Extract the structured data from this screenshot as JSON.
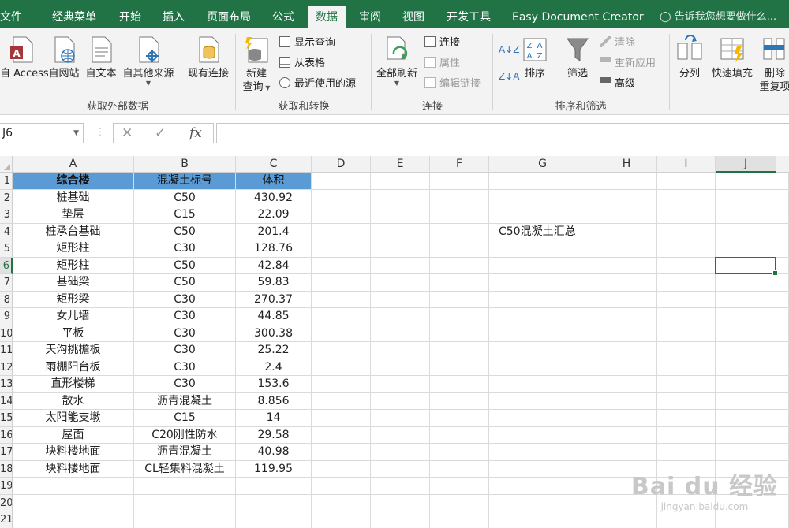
{
  "tabs": [
    {
      "label": "文件",
      "active": false
    },
    {
      "label": "经典菜单",
      "active": false
    },
    {
      "label": "开始",
      "active": false
    },
    {
      "label": "插入",
      "active": false
    },
    {
      "label": "页面布局",
      "active": false
    },
    {
      "label": "公式",
      "active": false
    },
    {
      "label": "数据",
      "active": true
    },
    {
      "label": "审阅",
      "active": false
    },
    {
      "label": "视图",
      "active": false
    },
    {
      "label": "开发工具",
      "active": false
    },
    {
      "label": "Easy Document Creator",
      "active": false
    }
  ],
  "tell_me": "告诉我您想要做什么...",
  "ribbon": {
    "external": {
      "access": "自 Access",
      "web": "自网站",
      "text": "自文本",
      "other": "自其他来源",
      "existing": "现有连接",
      "group": "获取外部数据"
    },
    "transform": {
      "new_query_1": "新建",
      "new_query_2": "查询",
      "show_queries": "显示查询",
      "from_table": "从表格",
      "recent_sources": "最近使用的源",
      "group": "获取和转换"
    },
    "connections": {
      "refresh_all": "全部刷新",
      "connections": "连接",
      "properties": "属性",
      "edit_links": "编辑链接",
      "group": "连接"
    },
    "sort_filter": {
      "sort": "排序",
      "filter": "筛选",
      "clear": "清除",
      "reapply": "重新应用",
      "advanced": "高级",
      "group": "排序和筛选"
    },
    "tools": {
      "split": "分列",
      "flash_fill": "快速填充",
      "remove_dup_1": "删除",
      "remove_dup_2": "重复项"
    }
  },
  "formula_bar": {
    "name_box": "J6",
    "formula": ""
  },
  "columns": [
    "A",
    "B",
    "C",
    "D",
    "E",
    "F",
    "G",
    "H",
    "I",
    "J"
  ],
  "rows": [
    "1",
    "2",
    "3",
    "4",
    "5",
    "6",
    "7",
    "8",
    "9",
    "10",
    "11",
    "12",
    "13",
    "14",
    "15",
    "16",
    "17",
    "18",
    "19",
    "20",
    "21"
  ],
  "selected_cell": "J6",
  "table": {
    "headers": [
      "综合楼",
      "混凝土标号",
      "体积"
    ],
    "rows": [
      [
        "桩基础",
        "C50",
        "430.92"
      ],
      [
        "垫层",
        "C15",
        "22.09"
      ],
      [
        "桩承台基础",
        "C50",
        "201.4"
      ],
      [
        "矩形柱",
        "C30",
        "128.76"
      ],
      [
        "矩形柱",
        "C50",
        "42.84"
      ],
      [
        "基础梁",
        "C50",
        "59.83"
      ],
      [
        "矩形梁",
        "C30",
        "270.37"
      ],
      [
        "女儿墙",
        "C30",
        "44.85"
      ],
      [
        "平板",
        "C30",
        "300.38"
      ],
      [
        "天沟挑檐板",
        "C30",
        "25.22"
      ],
      [
        "雨棚阳台板",
        "C30",
        "2.4"
      ],
      [
        "直形楼梯",
        "C30",
        "153.6"
      ],
      [
        "散水",
        "沥青混凝土",
        "8.856"
      ],
      [
        "太阳能支墩",
        "C15",
        "14"
      ],
      [
        "屋面",
        "C20刚性防水",
        "29.58"
      ],
      [
        "块料楼地面",
        "沥青混凝土",
        "40.98"
      ],
      [
        "块料楼地面",
        "CL轻集料混凝土",
        "119.95"
      ]
    ]
  },
  "g4_note": "C50混凝土汇总",
  "watermark": {
    "brand": "Bai du 经验",
    "url": "jingyan.baidu.com"
  },
  "colors": {
    "excel_green": "#217346",
    "header_fill": "#5b9bd5"
  }
}
